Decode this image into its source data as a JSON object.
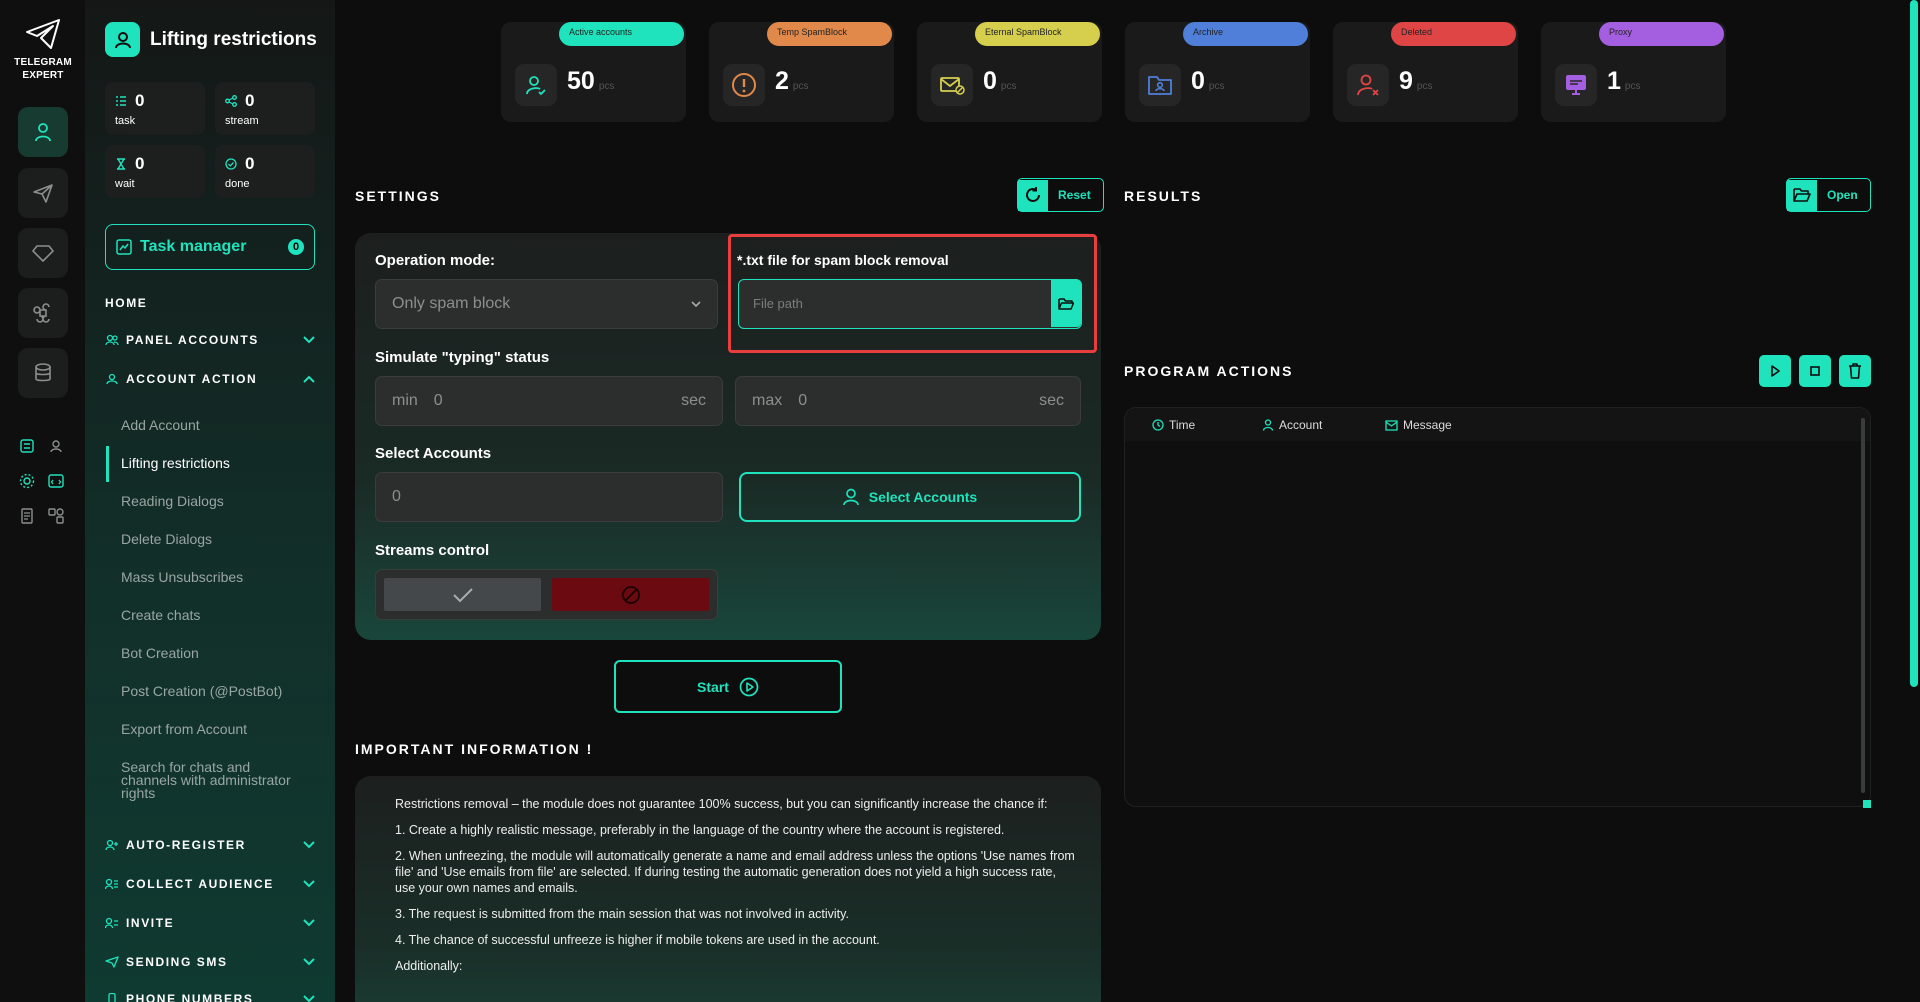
{
  "rail": {
    "logo_line1": "TELEGRAM",
    "logo_line2": "EXPERT"
  },
  "sidebar": {
    "title": "Lifting restrictions",
    "stats": [
      {
        "value": "0",
        "label": "task"
      },
      {
        "value": "0",
        "label": "stream"
      },
      {
        "value": "0",
        "label": "wait"
      },
      {
        "value": "0",
        "label": "done"
      }
    ],
    "task_manager": {
      "label": "Task manager",
      "count": "0"
    },
    "home": "HOME",
    "panel_accounts": "PANEL ACCOUNTS",
    "account_action": "ACCOUNT ACTION",
    "items": [
      "Add Account",
      "Lifting restrictions",
      "Reading Dialogs",
      "Delete Dialogs",
      "Mass Unsubscribes",
      "Create chats",
      "Bot Creation",
      "Post Creation (@PostBot)",
      "Export from Account",
      "Search for chats and channels with administrator rights"
    ],
    "auto_register": "AUTO-REGISTER",
    "collect_audience": "COLLECT AUDIENCE",
    "invite": "INVITE",
    "sending_sms": "SENDING SMS",
    "phone_numbers": "PHONE NUMBERS"
  },
  "cards": [
    {
      "label": "Active accounts",
      "value": "50",
      "unit": "pcs",
      "color": "#1fe3bd"
    },
    {
      "label": "Temp SpamBlock",
      "value": "2",
      "unit": "pcs",
      "color": "#e0894a"
    },
    {
      "label": "Eternal SpamBlock",
      "value": "0",
      "unit": "pcs",
      "color": "#d6cf4e"
    },
    {
      "label": "Archive",
      "value": "0",
      "unit": "pcs",
      "color": "#4f7fd9"
    },
    {
      "label": "Deleted",
      "value": "9",
      "unit": "pcs",
      "color": "#e04545"
    },
    {
      "label": "Proxy",
      "value": "1",
      "unit": "pcs",
      "color": "#a45fe0"
    }
  ],
  "settings": {
    "title": "SETTINGS",
    "reset": "Reset",
    "operation_mode_label": "Operation mode:",
    "operation_mode_value": "Only spam block",
    "file_label": "*.txt file for spam block removal",
    "file_placeholder": "File path",
    "typing_label": "Simulate \"typing\" status",
    "min_label": "min",
    "min_value": "0",
    "max_label": "max",
    "max_value": "0",
    "unit": "sec",
    "select_accounts_label": "Select Accounts",
    "select_accounts_value": "0",
    "select_accounts_button": "Select Accounts",
    "streams_label": "Streams control",
    "start": "Start"
  },
  "info": {
    "title": "IMPORTANT INFORMATION !",
    "paragraphs": [
      "Restrictions removal – the module does not guarantee 100% success, but you can significantly increase the chance if:",
      "1. Create a highly realistic message, preferably in the language of the country where the account is registered.",
      "2. When unfreezing, the module will automatically generate a name and email address unless the options 'Use names from file' and 'Use emails from file' are selected. If during testing the automatic generation does not yield a high success rate, use your own names and emails.",
      "3. The request is submitted from the main session that was not involved in activity.",
      "4. The chance of successful unfreeze is higher if mobile tokens are used in the account.",
      "Additionally:"
    ]
  },
  "results": {
    "title": "RESULTS",
    "open": "Open"
  },
  "program_actions": {
    "title": "PROGRAM ACTIONS",
    "columns": [
      "Time",
      "Account",
      "Message"
    ]
  },
  "colors": {
    "accent": "#1fe3bd",
    "highlight": "#ea3d3d",
    "stop": "#6b0a10"
  }
}
